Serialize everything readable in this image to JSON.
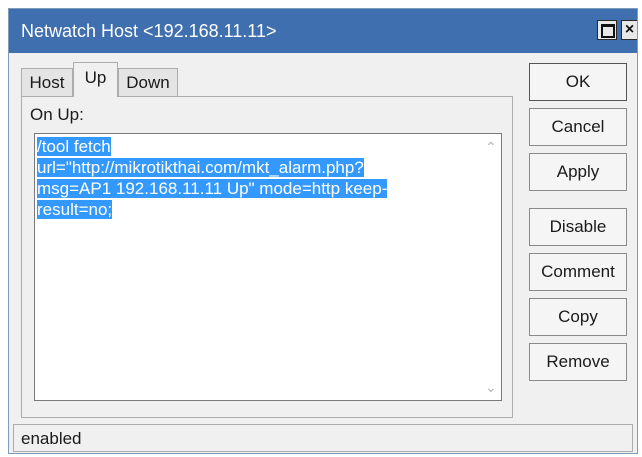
{
  "window": {
    "title": "Netwatch Host <192.168.11.11>"
  },
  "titlebar_buttons": {
    "close_glyph": "×"
  },
  "tabs": [
    {
      "label": "Host",
      "active": false
    },
    {
      "label": "Up",
      "active": true
    },
    {
      "label": "Down",
      "active": false
    }
  ],
  "on_up": {
    "label": "On Up:",
    "script_lines": [
      "/tool fetch",
      "url=\"http://mikrotikthai.com/mkt_alarm.php?",
      "msg=AP1 192.168.11.11 Up\" mode=http keep-",
      "result=no;"
    ]
  },
  "buttons": {
    "ok": "OK",
    "cancel": "Cancel",
    "apply": "Apply",
    "disable": "Disable",
    "comment": "Comment",
    "copy": "Copy",
    "remove": "Remove"
  },
  "status": {
    "text": "enabled"
  },
  "icons": [
    "maximize-icon",
    "close-icon",
    "scroll-up-arrow-icon",
    "scroll-down-arrow-icon"
  ],
  "colors": {
    "titlebar": "#3f6fae",
    "selection": "#3399ff"
  }
}
